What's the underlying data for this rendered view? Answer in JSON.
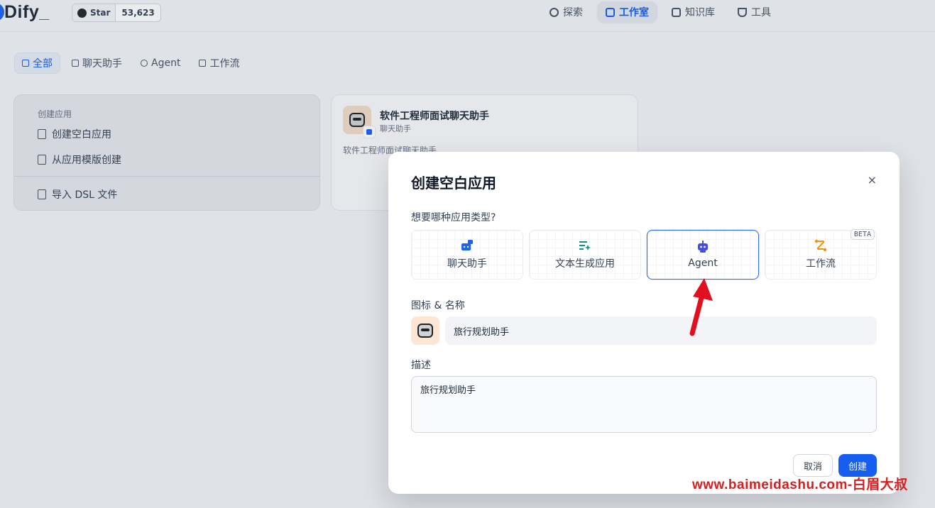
{
  "header": {
    "logo": "Dify",
    "github_star_label": "Star",
    "github_star_count": "53,623",
    "nav": [
      {
        "label": "探索",
        "icon": "compass-icon"
      },
      {
        "label": "工作室",
        "icon": "robot-icon"
      },
      {
        "label": "知识库",
        "icon": "book-icon"
      },
      {
        "label": "工具",
        "icon": "hammer-icon"
      }
    ]
  },
  "filter_tabs": [
    {
      "label": "全部",
      "icon": "grid-icon"
    },
    {
      "label": "聊天助手",
      "icon": "chat-icon"
    },
    {
      "label": "Agent",
      "icon": "agent-icon"
    },
    {
      "label": "工作流",
      "icon": "workflow-icon"
    }
  ],
  "create_card": {
    "title": "创建应用",
    "items": [
      {
        "label": "创建空白应用"
      },
      {
        "label": "从应用模版创建"
      },
      {
        "label": "导入 DSL 文件"
      }
    ]
  },
  "app_card": {
    "name": "软件工程师面试聊天助手",
    "type": "聊天助手",
    "description": "软件工程师面试聊天助手"
  },
  "modal": {
    "title": "创建空白应用",
    "close": "×",
    "type_question": "想要哪种应用类型?",
    "app_types": [
      {
        "label": "聊天助手",
        "color": "#1c64f2"
      },
      {
        "label": "文本生成应用",
        "color": "#0e9384"
      },
      {
        "label": "Agent",
        "color": "#444ce7"
      },
      {
        "label": "工作流",
        "color": "#f79009"
      }
    ],
    "beta_badge": "BETA",
    "name_label": "图标 & 名称",
    "name_value": "旅行规划助手",
    "desc_label": "描述",
    "desc_value": "旅行规划助手",
    "cancel": "取消",
    "create": "创建"
  },
  "watermark": "www.baimeidashu.com-白眉大叔",
  "colors": {
    "accent": "#155eef",
    "annotation": "#e0101e"
  }
}
